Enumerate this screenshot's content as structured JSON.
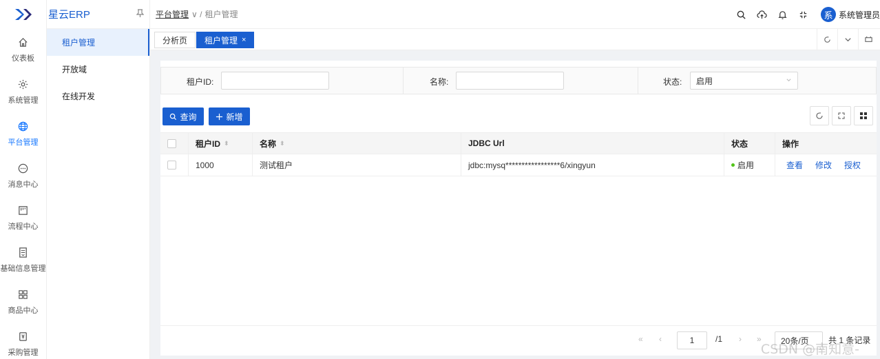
{
  "brand": {
    "name": "星云ERP"
  },
  "rail": [
    {
      "label": "仪表板",
      "icon": "home-icon"
    },
    {
      "label": "系统管理",
      "icon": "gear-icon"
    },
    {
      "label": "平台管理",
      "icon": "globe-icon",
      "active": true
    },
    {
      "label": "消息中心",
      "icon": "chat-icon"
    },
    {
      "label": "流程中心",
      "icon": "flow-icon"
    },
    {
      "label": "基础信息管理",
      "icon": "document-icon"
    },
    {
      "label": "商品中心",
      "icon": "grid-icon"
    },
    {
      "label": "采购管理",
      "icon": "purchase-icon"
    }
  ],
  "submenu": [
    {
      "label": "租户管理",
      "active": true
    },
    {
      "label": "开放域"
    },
    {
      "label": "在线开发"
    }
  ],
  "breadcrumb": {
    "first": "平台管理",
    "sep": "∨ /",
    "current": "租户管理"
  },
  "header": {
    "avatar_char": "系",
    "user": "系统管理员"
  },
  "tabs": [
    {
      "label": "分析页"
    },
    {
      "label": "租户管理",
      "close": "×",
      "active": true
    }
  ],
  "filter": {
    "tenant_id_label": "租户ID:",
    "tenant_id_value": "",
    "name_label": "名称:",
    "name_value": "",
    "status_label": "状态:",
    "status_value": "启用"
  },
  "actions": {
    "query": "查询",
    "add": "新增"
  },
  "table": {
    "columns": [
      "租户ID",
      "名称",
      "JDBC Url",
      "状态",
      "操作"
    ],
    "rows": [
      {
        "id": "1000",
        "name": "测试租户",
        "jdbc": "jdbc:mysq*****************6/xingyun",
        "status": "启用",
        "ops": [
          "查看",
          "修改",
          "授权"
        ]
      }
    ]
  },
  "pagination": {
    "first": "«",
    "prev": "‹",
    "page": "1",
    "total_pages": "/1",
    "next": "›",
    "last": "»",
    "page_size": "20条/页",
    "total": "共 1 条记录"
  },
  "watermark": "CSDN @南知意-",
  "colors": {
    "primary": "#1a5fd0",
    "status_ok": "#52c41a"
  }
}
